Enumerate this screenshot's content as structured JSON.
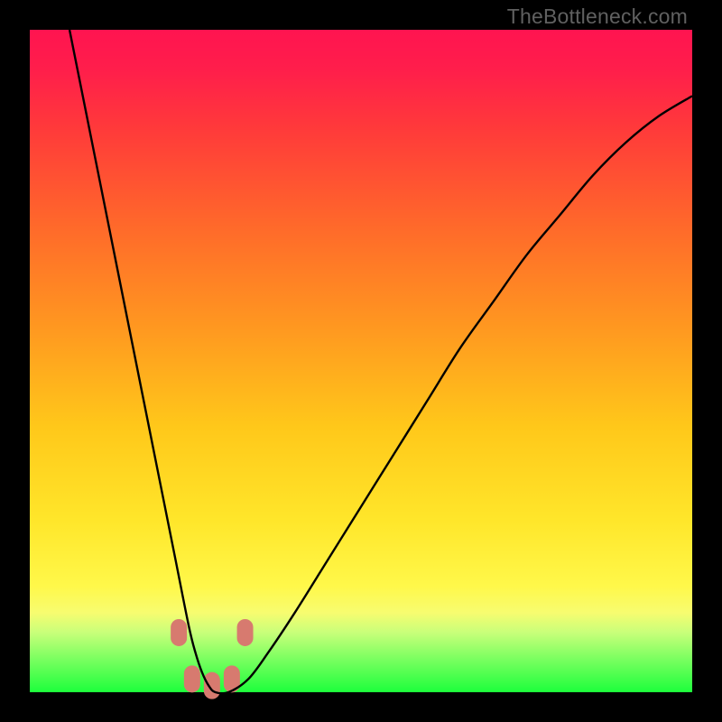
{
  "watermark": "TheBottleneck.com",
  "chart_data": {
    "type": "line",
    "title": "",
    "xlabel": "",
    "ylabel": "",
    "xlim": [
      0,
      100
    ],
    "ylim": [
      0,
      100
    ],
    "series": [
      {
        "name": "curve",
        "x": [
          6,
          8,
          10,
          12,
          14,
          16,
          18,
          20,
          22,
          24,
          25,
          26,
          27,
          28,
          30,
          33,
          36,
          40,
          45,
          50,
          55,
          60,
          65,
          70,
          75,
          80,
          85,
          90,
          95,
          100
        ],
        "values": [
          100,
          90,
          80,
          70,
          60,
          50,
          40,
          30,
          20,
          10,
          6,
          3,
          1,
          0,
          0,
          2,
          6,
          12,
          20,
          28,
          36,
          44,
          52,
          59,
          66,
          72,
          78,
          83,
          87,
          90
        ]
      }
    ],
    "markers": [
      {
        "x": 22.5,
        "y": 9
      },
      {
        "x": 24.5,
        "y": 2
      },
      {
        "x": 27.5,
        "y": 1
      },
      {
        "x": 30.5,
        "y": 2
      },
      {
        "x": 32.5,
        "y": 9
      }
    ],
    "marker_color": "#d77a6f",
    "curve_color": "#000000"
  }
}
